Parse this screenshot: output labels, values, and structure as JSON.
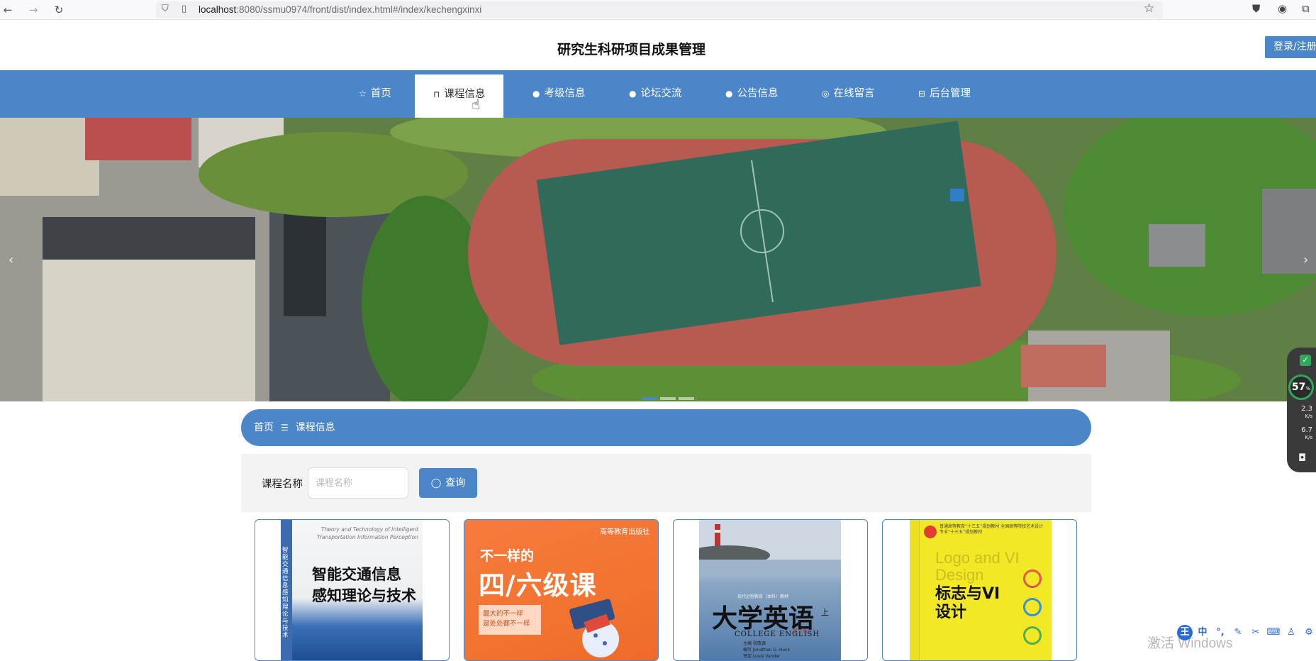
{
  "browser": {
    "url_host": "localhost",
    "url_path": ":8080/ssmu0974/front/dist/index.html#/index/kechengxinxi"
  },
  "header": {
    "title": "研究生科研项目成果管理",
    "login_label": "登录/注册"
  },
  "nav": {
    "items": [
      {
        "label": "首页",
        "icon": "star-icon"
      },
      {
        "label": "课程信息",
        "icon": "bag-icon",
        "active": true
      },
      {
        "label": "考级信息",
        "icon": "info-icon"
      },
      {
        "label": "论坛交流",
        "icon": "question-icon"
      },
      {
        "label": "公告信息",
        "icon": "info-icon"
      },
      {
        "label": "在线留言",
        "icon": "chat-icon"
      },
      {
        "label": "后台管理",
        "icon": "gift-icon"
      }
    ]
  },
  "breadcrumb": {
    "home": "首页",
    "current": "课程信息"
  },
  "search": {
    "label": "课程名称",
    "placeholder": "课程名称",
    "value": "",
    "button_label": "查询"
  },
  "cards": [
    {
      "cover_en": "Theory and Technology of Intelligent Transportation Information Perception",
      "cover_title_1": "智能交通信息",
      "cover_title_2": "感知理论与技术",
      "spine": "智能交通信息感知理论与技术"
    },
    {
      "publisher": "高等教育出版社",
      "line1": "不一样的",
      "line2": "四/六级课",
      "tag1": "最大的不一样",
      "tag2": "是处处都不一样"
    },
    {
      "small": "现代远程教育（本科）教材",
      "title": "大学英语",
      "volume": "上",
      "subtitle": "COLLEGE ENGLISH",
      "edition": "第三版",
      "meta1": "主编 张敬源",
      "meta2": "编写 Jonathan G. Huck",
      "meta3": "审定 Louis Vander"
    },
    {
      "header": "普通高等教育“十三五”规划教材 全国高等院校艺术设计专业“十三五”规划教材",
      "title_en_1": "Logo and VI",
      "title_en_2": "Design",
      "title_cn_1": "标志与VI",
      "title_cn_2": "设计"
    }
  ],
  "widget": {
    "percent": "57",
    "percent_unit": "%",
    "up_speed": "2.3",
    "up_unit": "K/s",
    "down_speed": "6.7",
    "down_unit": "K/s"
  },
  "watermark": "激活 Windows",
  "ime": {
    "logo": "王",
    "lang": "中"
  },
  "colors": {
    "primary": "#4a86c8",
    "widget_green": "#2ea85a"
  }
}
